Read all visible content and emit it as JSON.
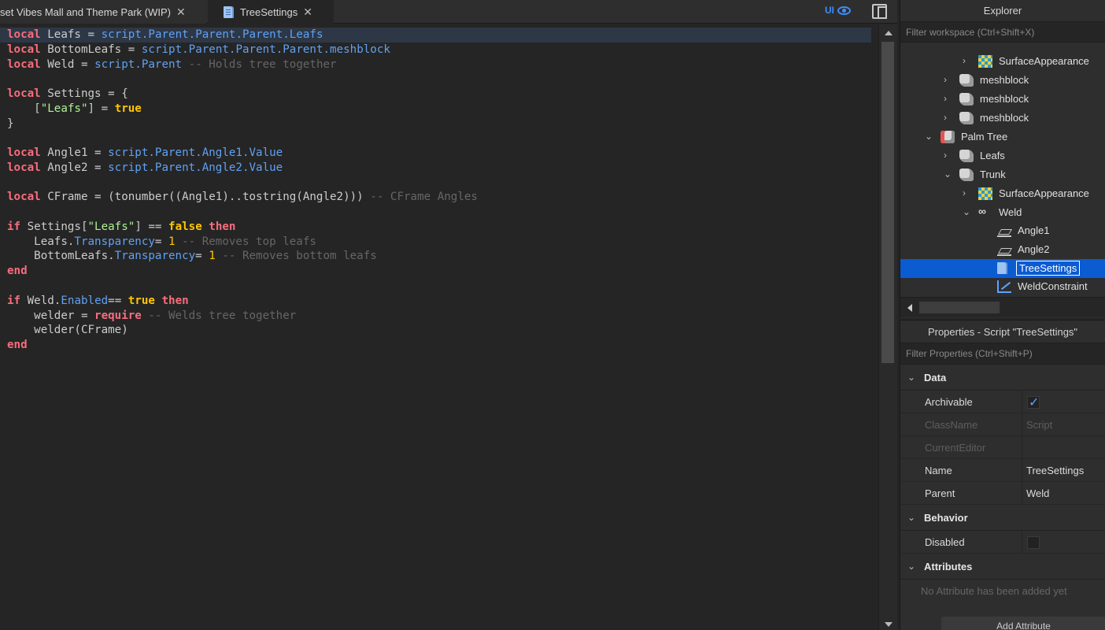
{
  "tabs": [
    {
      "label": "set Vibes Mall and Theme Park (WIP)",
      "active": false
    },
    {
      "label": "TreeSettings",
      "active": true
    }
  ],
  "toolbar": {
    "ui_label": "UI"
  },
  "code": {
    "lines": [
      [
        [
          "kw",
          "local"
        ],
        [
          "",
          "Leafs = "
        ],
        [
          "prop",
          "script.Parent.Parent.Parent.Leafs"
        ]
      ],
      [
        [
          "kw",
          "local"
        ],
        [
          "",
          "BottomLeafs = "
        ],
        [
          "prop",
          "script.Parent.Parent.Parent.meshblock"
        ]
      ],
      [
        [
          "kw",
          "local"
        ],
        [
          "",
          "Weld = "
        ],
        [
          "prop",
          "script.Parent"
        ],
        [
          "",
          ""
        ],
        [
          "cmt",
          " -- Holds tree together"
        ]
      ],
      [],
      [
        [
          "kw",
          "local"
        ],
        [
          "",
          "Settings = {"
        ]
      ],
      [
        [
          "",
          "    ["
        ],
        [
          "str",
          "\"Leafs\""
        ],
        [
          "",
          "] = "
        ],
        [
          "bool",
          "true"
        ]
      ],
      [
        [
          "",
          "}"
        ]
      ],
      [],
      [
        [
          "kw",
          "local"
        ],
        [
          "",
          "Angle1 = "
        ],
        [
          "prop",
          "script.Parent.Angle1.Value"
        ]
      ],
      [
        [
          "kw",
          "local"
        ],
        [
          "",
          "Angle2 = "
        ],
        [
          "prop",
          "script.Parent.Angle2.Value"
        ]
      ],
      [],
      [
        [
          "kw",
          "local"
        ],
        [
          "",
          "CFrame = (tonumber((Angle1)..tostring(Angle2)))"
        ],
        [
          "cmt",
          " -- CFrame Angles"
        ]
      ],
      [],
      [
        [
          "kw",
          "if"
        ],
        [
          "",
          "Settings["
        ],
        [
          "str",
          "\"Leafs\""
        ],
        [
          "",
          "] == "
        ],
        [
          "bool",
          "false"
        ],
        [
          "",
          ""
        ],
        [
          "kw",
          " then"
        ]
      ],
      [
        [
          "",
          "    Leafs."
        ],
        [
          "prop",
          "Transparency"
        ],
        [
          "",
          ""
        ],
        [
          "",
          ""
        ],
        [
          "num",
          ""
        ],
        [
          "",
          ""
        ],
        [
          "",
          "= "
        ],
        [
          "num",
          "1"
        ],
        [
          "cmt",
          " -- Removes top leafs"
        ]
      ],
      [
        [
          "",
          "    BottomLeafs."
        ],
        [
          "prop",
          "Transparency"
        ],
        [
          "",
          ""
        ],
        [
          "",
          "= "
        ],
        [
          "num",
          "1"
        ],
        [
          "cmt",
          " -- Removes bottom leafs"
        ]
      ],
      [
        [
          "kw",
          "end"
        ]
      ],
      [],
      [
        [
          "kw",
          "if"
        ],
        [
          "",
          "Weld."
        ],
        [
          "prop",
          "Enabled"
        ],
        [
          "",
          ""
        ],
        [
          "",
          ""
        ],
        [
          "",
          ""
        ],
        [
          "",
          ""
        ],
        [
          "",
          ""
        ],
        [
          "",
          ""
        ],
        [
          "",
          ""
        ],
        [
          "",
          ""
        ],
        [
          "",
          "== "
        ],
        [
          "bool",
          "true"
        ],
        [
          "kw",
          " then"
        ]
      ],
      [
        [
          "",
          "    welder = "
        ],
        [
          "kw",
          "require"
        ],
        [
          "cmt",
          " -- Welds tree together"
        ]
      ],
      [
        [
          "",
          "    welder(CFrame)"
        ]
      ],
      [
        [
          "kw",
          "end"
        ]
      ]
    ]
  },
  "explorer": {
    "title": "Explorer",
    "filter_placeholder": "Filter workspace (Ctrl+Shift+X)",
    "nodes": [
      {
        "label": "SurfaceAppearance",
        "depth": 3,
        "arrow": "›",
        "icon": "surface-appearance-icon"
      },
      {
        "label": "meshblock",
        "depth": 2,
        "arrow": "›",
        "icon": "meshpart-icon"
      },
      {
        "label": "meshblock",
        "depth": 2,
        "arrow": "›",
        "icon": "meshpart-icon"
      },
      {
        "label": "meshblock",
        "depth": 2,
        "arrow": "›",
        "icon": "meshpart-icon"
      },
      {
        "label": "Palm Tree",
        "depth": 1,
        "arrow": "⌄",
        "icon": "model-icon"
      },
      {
        "label": "Leafs",
        "depth": 2,
        "arrow": "›",
        "icon": "meshpart-icon"
      },
      {
        "label": "Trunk",
        "depth": 2,
        "arrow": "⌄",
        "icon": "meshpart-icon"
      },
      {
        "label": "SurfaceAppearance",
        "depth": 3,
        "arrow": "›",
        "icon": "surface-appearance-icon"
      },
      {
        "label": "Weld",
        "depth": 3,
        "arrow": "⌄",
        "icon": "weld-icon"
      },
      {
        "label": "Angle1",
        "depth": 4,
        "arrow": "",
        "icon": "number-value-icon"
      },
      {
        "label": "Angle2",
        "depth": 4,
        "arrow": "",
        "icon": "number-value-icon"
      },
      {
        "label": "TreeSettings",
        "depth": 4,
        "arrow": "",
        "icon": "script-icon",
        "selected": true
      },
      {
        "label": "WeldConstraint",
        "depth": 4,
        "arrow": "",
        "icon": "weld-constraint-icon"
      }
    ]
  },
  "properties": {
    "title": "Properties - Script \"TreeSettings\"",
    "filter_placeholder": "Filter Properties (Ctrl+Shift+P)",
    "sections": {
      "data": "Data",
      "behavior": "Behavior",
      "attributes": "Attributes"
    },
    "rows": {
      "archivable": {
        "key": "Archivable",
        "checked": true
      },
      "classname": {
        "key": "ClassName",
        "value": "Script"
      },
      "currenteditor": {
        "key": "CurrentEditor",
        "value": ""
      },
      "name": {
        "key": "Name",
        "value": "TreeSettings"
      },
      "parent": {
        "key": "Parent",
        "value": "Weld"
      },
      "disabled": {
        "key": "Disabled",
        "checked": false
      }
    },
    "no_attributes": "No Attribute has been added yet",
    "add_attribute_label": "Add Attribute"
  }
}
